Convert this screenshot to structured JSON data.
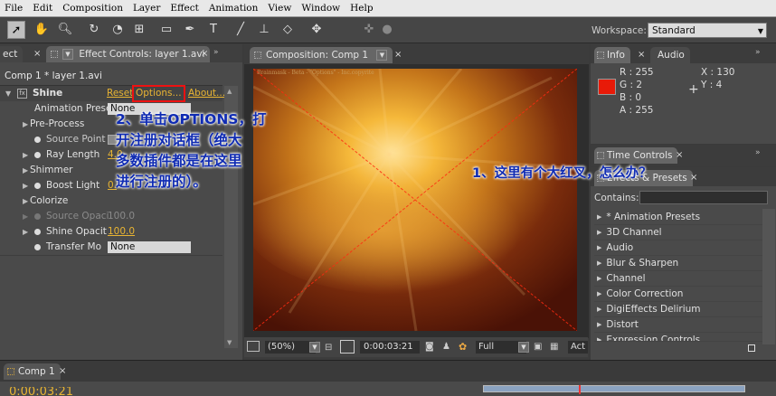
{
  "menu": [
    "File",
    "Edit",
    "Composition",
    "Layer",
    "Effect",
    "Animation",
    "View",
    "Window",
    "Help"
  ],
  "toolbar": {
    "workspace_label": "Workspace:",
    "workspace_value": "Standard"
  },
  "effect_controls": {
    "tab_left": "ect",
    "tab_label": "Effect Controls: layer 1.avi",
    "breadcrumb": "Comp 1 * layer 1.avi",
    "effect_name": "Shine",
    "reset": "Reset",
    "options": "Options...",
    "about": "About...",
    "rows": [
      {
        "label": "Animation Prese",
        "value": "None"
      },
      {
        "label": "Pre-Process",
        "value": ""
      },
      {
        "label": "Source Point",
        "value": ""
      },
      {
        "label": "Ray Length",
        "value": "4.0"
      },
      {
        "label": "Shimmer",
        "value": ""
      },
      {
        "label": "Boost Light",
        "value": "0."
      },
      {
        "label": "Colorize",
        "value": ""
      },
      {
        "label": "Source Opaci",
        "value": "100.0"
      },
      {
        "label": "Shine Opacit",
        "value": "100.0"
      },
      {
        "label": "Transfer Mo",
        "value": "None"
      }
    ]
  },
  "composition": {
    "tab_label": "Composition: Comp 1",
    "watermark": "Brainmask - Beta - \"Options\" - Inc.copyrite",
    "zoom": "(50%)",
    "timecode": "0:00:03:21",
    "resolution": "Full",
    "active_camera": "Act"
  },
  "info": {
    "tab_label": "Info",
    "audio_tab": "Audio",
    "r": "R : 255",
    "g": "G : 2",
    "b": "B : 0",
    "a": "A : 255",
    "x": "X : 130",
    "y": "Y : 4",
    "swatch_color": "#e81a08"
  },
  "time_controls": {
    "tab_label": "Time Controls"
  },
  "effects_presets": {
    "tab_label": "Effects & Presets",
    "contains_label": "Contains:",
    "items": [
      "* Animation Presets",
      "3D Channel",
      "Audio",
      "Blur & Sharpen",
      "Channel",
      "Color Correction",
      "DigiEffects Delirium",
      "Distort",
      "Expression Controls"
    ]
  },
  "annotations": {
    "step2_line1": "2、单击OPTIONS，打",
    "step2_line2": "开注册对话框（绝大",
    "step2_line3": "多数插件都是在这里",
    "step2_line4": "进行注册的）。",
    "step1": "1、这里有个大红叉，怎么办？"
  },
  "timeline": {
    "tab_label": "Comp 1",
    "timecode": "0:00:03:21"
  }
}
